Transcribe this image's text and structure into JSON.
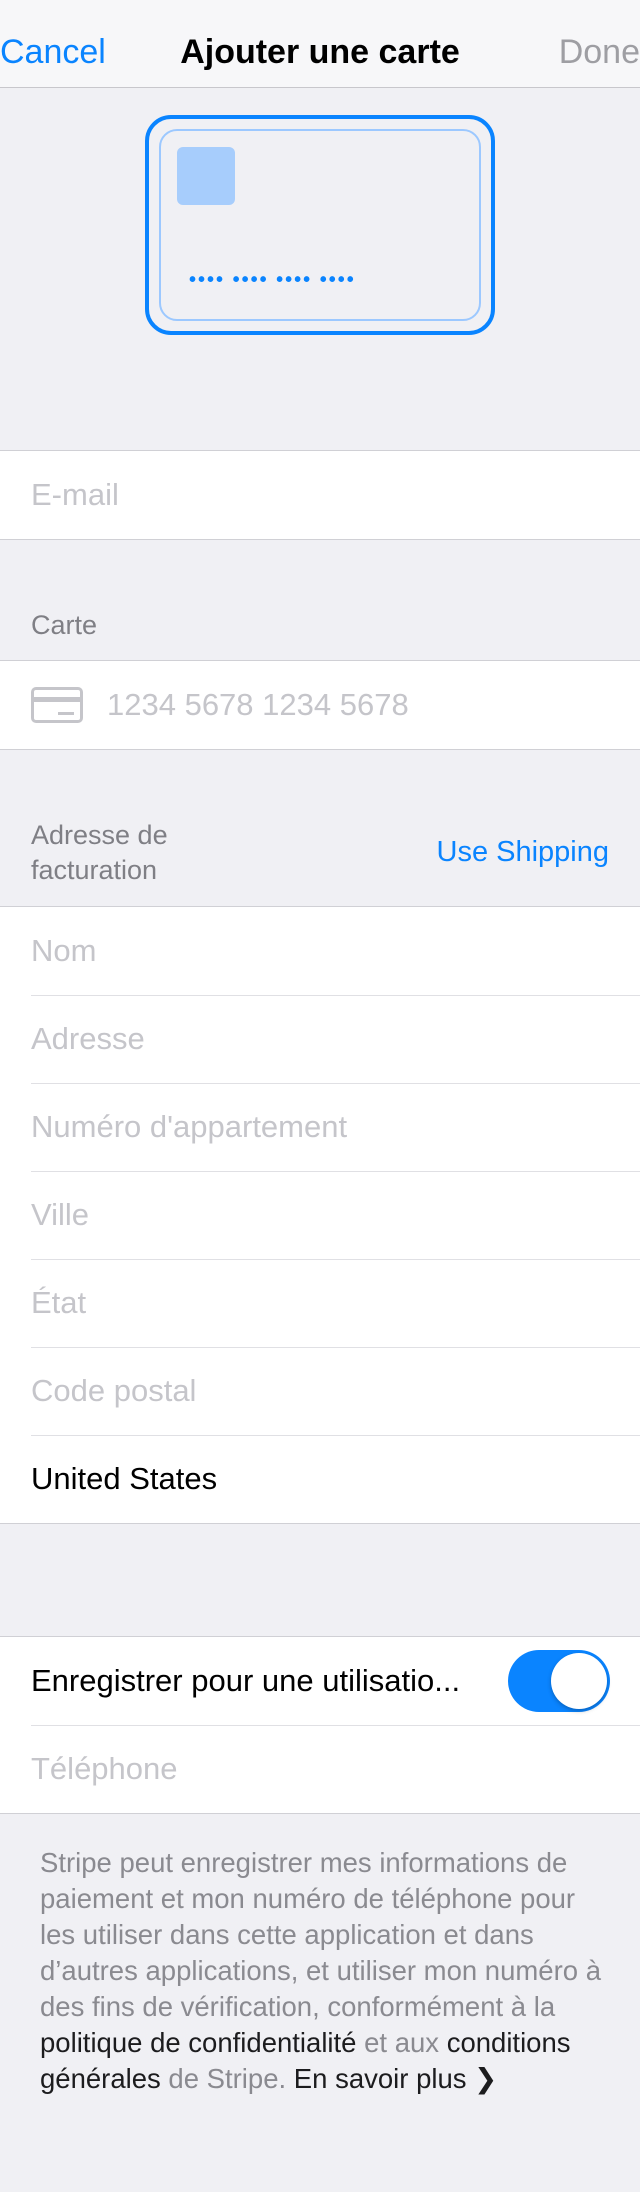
{
  "nav": {
    "cancel": "Cancel",
    "title": "Ajouter une carte",
    "done": "Done"
  },
  "card_preview": {
    "number_mask": "•••• •••• •••• ••••"
  },
  "email": {
    "placeholder": "E-mail"
  },
  "card_section": {
    "header": "Carte",
    "number_placeholder": "1234 5678 1234 5678"
  },
  "billing": {
    "header_line1": "Adresse de",
    "header_line2": "facturation",
    "use_shipping": "Use Shipping",
    "fields": [
      {
        "placeholder": "Nom"
      },
      {
        "placeholder": "Adresse"
      },
      {
        "placeholder": "Numéro d'appartement"
      },
      {
        "placeholder": "Ville"
      },
      {
        "placeholder": "État"
      },
      {
        "placeholder": "Code postal"
      }
    ],
    "country": "United States"
  },
  "link": {
    "save_label": "Enregistrer pour une utilisatio...",
    "toggle_on": true,
    "phone_placeholder": "Téléphone"
  },
  "footer": {
    "text_a": "Stripe peut enregistrer mes informations de paiement et mon numéro de téléphone pour les utiliser dans cette application et dans d’autres applications, et utiliser mon numéro à des fins de vérification, conformément à la ",
    "privacy": "politique de confidentialité",
    "text_b": " et aux ",
    "terms": "conditions générales",
    "text_c": " de Stripe. ",
    "learn_more": "En savoir plus",
    "chevron": "❯"
  },
  "colors": {
    "accent": "#0a84ff",
    "background": "#f0f0f4",
    "placeholder": "#c5c5ca"
  }
}
